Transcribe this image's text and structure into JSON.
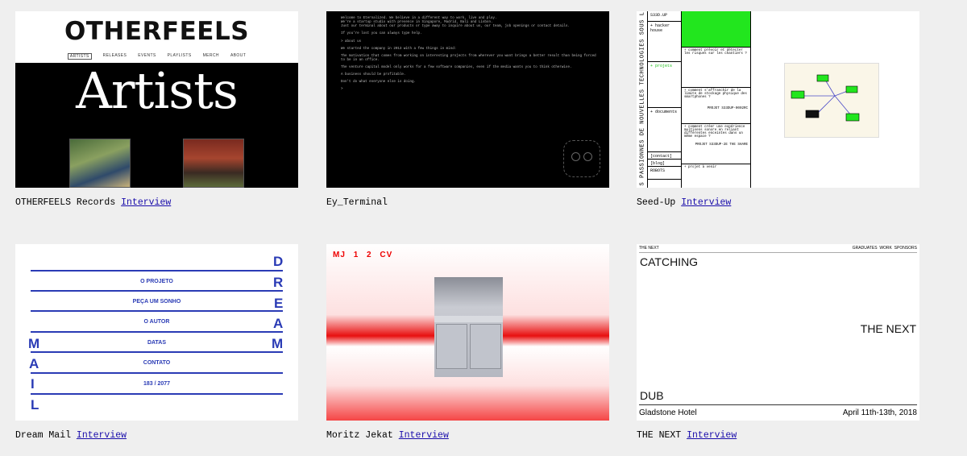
{
  "cards": [
    {
      "title": "OTHERFEELS Records",
      "link": "Interview",
      "thumb": {
        "logo": "OTHERFEELS",
        "nav": [
          "ARTISTS",
          "RELEASES",
          "EVENTS",
          "PLAYLISTS",
          "MERCH",
          "ABOUT"
        ],
        "heading": "Artists"
      }
    },
    {
      "title": "Ey_Terminal",
      "link": "",
      "thumb": {
        "lines": [
          "Welcome to Eternalized. We believe in a different way to work, live and play.",
          "We're a startup studio with presence in Singapore, Madrid, Bali and Lisbon.",
          "Just our terminal about our products or type away to inquire about us, our team, job openings or contact details.",
          "If you're lost you can always type help.",
          "> about us",
          "We started the company in 2013 with a few things in mind:",
          "The motivation that comes from working on interesting projects from wherever you want brings a better result than being forced",
          "to be in an office.",
          "The venture capital model only works for a few software companies, even if the media wants you to think otherwise.",
          "A business should be profitable.",
          "Don't do what everyone else is doing.",
          ">"
        ]
      }
    },
    {
      "title": "Seed-Up",
      "link": "Interview",
      "thumb": {
        "vertical": "S PASSIONNES DE NOUVELLES TECHNOLOGIES SOUS LE ST",
        "col1": [
          "S33D.UP",
          "+ hacker house",
          "+ projets",
          "+ documents",
          "[contact]",
          "[blog]",
          "ROBOTS"
        ],
        "col2": [
          "+ comment prévoir et détecter les risques sur les chantiers ?",
          "+ comment s'affranchir de la limite de stockage physique des smartphones ?",
          "PROJET S33DUP-0002RC",
          "+ comment créer une expérience multisens sonore en reliant différentes enceintes dans un même espace ?",
          "PROJET S33DUP-2E THE SHARE",
          "+ projet à venir"
        ]
      }
    },
    {
      "title": "Dream Mail",
      "link": "Interview",
      "thumb": {
        "rows": [
          "O PROJETO",
          "PEÇA UM SONHO",
          "O AUTOR",
          "DATAS",
          "CONTATO",
          "183 / 2077"
        ],
        "right_letters": [
          "D",
          "R",
          "E",
          "A",
          "M"
        ],
        "left_letters": [
          "M",
          "A",
          "I",
          "L"
        ]
      }
    },
    {
      "title": "Moritz Jekat",
      "link": "Interview",
      "thumb": {
        "nav": [
          "MJ",
          "1",
          "2",
          "CV"
        ]
      }
    },
    {
      "title": "THE NEXT",
      "link": "Interview",
      "thumb": {
        "brand": "THE NEXT",
        "nav": [
          "GRADUATES",
          "WORK",
          "SPONSORS"
        ],
        "line1": "CATCHING",
        "line2": "THE NEXT",
        "line3": "DUB",
        "venue": "Gladstone Hotel",
        "dates": "April 11th-13th, 2018"
      }
    }
  ],
  "colors": {
    "background": "#efefef",
    "link": "#1a0dab",
    "dream_blue": "#2a3bb5",
    "seed_green": "#22e61e",
    "moritz_red": "#e80f0f"
  }
}
